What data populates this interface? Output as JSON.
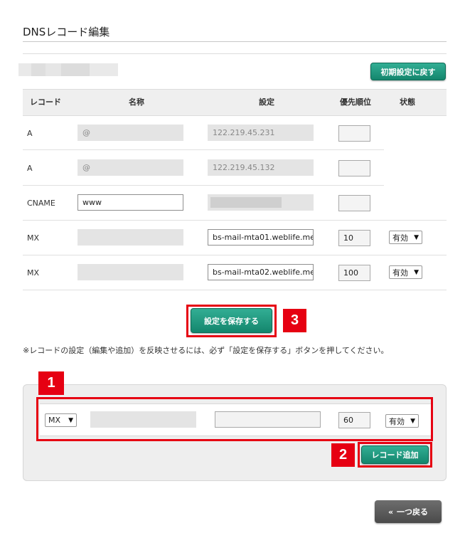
{
  "page": {
    "title": "DNSレコード編集",
    "reset_button": "初期設定に戻す"
  },
  "table": {
    "headers": {
      "record": "レコード",
      "name": "名称",
      "setting": "設定",
      "priority": "優先順位",
      "status": "状態"
    },
    "rows": [
      {
        "type": "A",
        "name": "@",
        "value": "122.219.45.231",
        "priority": "",
        "status": ""
      },
      {
        "type": "A",
        "name": "@",
        "value": "122.219.45.132",
        "priority": "",
        "status": ""
      },
      {
        "type": "CNAME",
        "name": "www",
        "value": "",
        "priority": "",
        "status": ""
      },
      {
        "type": "MX",
        "name": "",
        "value": "bs-mail-mta01.weblife.me",
        "priority": "10",
        "status": "有効"
      },
      {
        "type": "MX",
        "name": "",
        "value": "bs-mail-mta02.weblife.me",
        "priority": "100",
        "status": "有効"
      }
    ]
  },
  "save_button": "設定を保存する",
  "note": "※レコードの設定（編集や追加）を反映させるには、必ず「設定を保存する」ボタンを押してください。",
  "add_form": {
    "type": "MX",
    "name": "",
    "value": "",
    "priority": "60",
    "status": "有効",
    "add_button": "レコード追加"
  },
  "annotations": {
    "badge1": "1",
    "badge2": "2",
    "badge3": "3"
  },
  "back_button": "一つ戻る",
  "colors": {
    "accent_green": "#1e9a7e",
    "annotation_red": "#e60012",
    "back_button_gray": "#555555"
  }
}
